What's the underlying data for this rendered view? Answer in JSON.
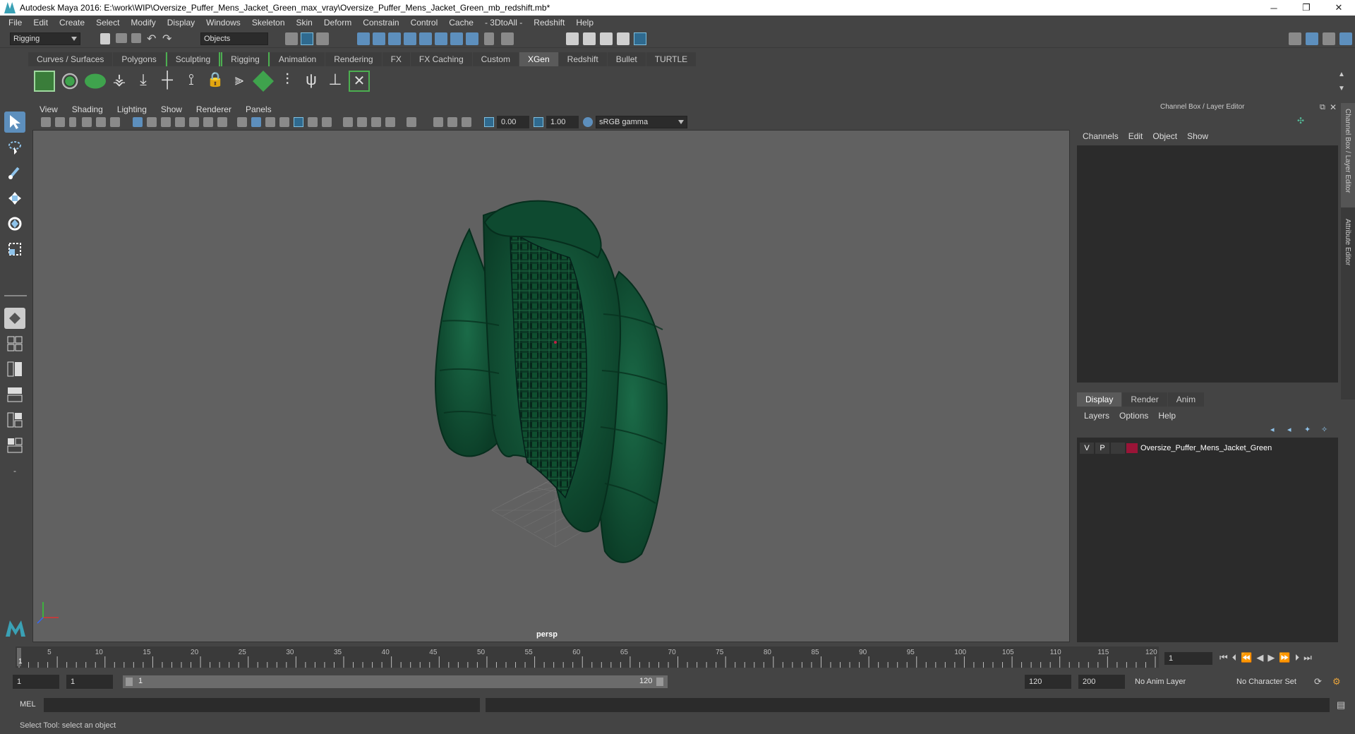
{
  "window": {
    "title": "Autodesk Maya 2016: E:\\work\\WIP\\Oversize_Puffer_Mens_Jacket_Green_max_vray\\Oversize_Puffer_Mens_Jacket_Green_mb_redshift.mb*",
    "minimize": "─",
    "restore": "❐",
    "close": "✕"
  },
  "menubar": [
    "File",
    "Edit",
    "Create",
    "Select",
    "Modify",
    "Display",
    "Windows",
    "Skeleton",
    "Skin",
    "Deform",
    "Constrain",
    "Control",
    "Cache",
    "- 3DtoAll -",
    "Redshift",
    "Help"
  ],
  "toolbar": {
    "menuset": "Rigging",
    "selection_mode": "Objects"
  },
  "shelf_tabs": [
    {
      "label": "Curves / Surfaces",
      "active": false
    },
    {
      "label": "Polygons",
      "active": false
    },
    {
      "label": "Sculpting",
      "active": false
    },
    {
      "label": "Rigging",
      "active": false
    },
    {
      "label": "Animation",
      "active": false
    },
    {
      "label": "Rendering",
      "active": false
    },
    {
      "label": "FX",
      "active": false
    },
    {
      "label": "FX Caching",
      "active": false
    },
    {
      "label": "Custom",
      "active": false
    },
    {
      "label": "XGen",
      "active": true
    },
    {
      "label": "Redshift",
      "active": false
    },
    {
      "label": "Bullet",
      "active": false
    },
    {
      "label": "TURTLE",
      "active": false
    }
  ],
  "viewport": {
    "menu": [
      "View",
      "Shading",
      "Lighting",
      "Show",
      "Renderer",
      "Panels"
    ],
    "exposure": "0.00",
    "gamma": "1.00",
    "color_space": "sRGB gamma",
    "camera_label": "persp"
  },
  "channel_box": {
    "title": "Channel Box / Layer Editor",
    "menu": [
      "Channels",
      "Edit",
      "Object",
      "Show"
    ]
  },
  "layer_editor": {
    "tabs": [
      {
        "label": "Display",
        "active": true
      },
      {
        "label": "Render",
        "active": false
      },
      {
        "label": "Anim",
        "active": false
      }
    ],
    "menu": [
      "Layers",
      "Options",
      "Help"
    ],
    "layer": {
      "visible": "V",
      "playback": "P",
      "name": "Oversize_Puffer_Mens_Jacket_Green",
      "color": "#9a1437"
    }
  },
  "side_tabs": {
    "channel_box": "Channel Box / Layer Editor",
    "attribute_editor": "Attribute Editor"
  },
  "timeline": {
    "ticks": [
      "5",
      "10",
      "15",
      "20",
      "25",
      "30",
      "35",
      "40",
      "45",
      "50",
      "55",
      "60",
      "65",
      "70",
      "75",
      "80",
      "85",
      "90",
      "95",
      "100",
      "105",
      "110",
      "115",
      "120"
    ],
    "start_tick": "1",
    "current_frame": "1"
  },
  "range": {
    "start": "1",
    "playback_start": "1",
    "slider_start": "1",
    "slider_end": "120",
    "playback_end": "120",
    "end": "200",
    "anim_layer": "No Anim Layer",
    "character_set": "No Character Set"
  },
  "command_line": {
    "language": "MEL"
  },
  "status": {
    "help_text": "Select Tool: select an object"
  }
}
